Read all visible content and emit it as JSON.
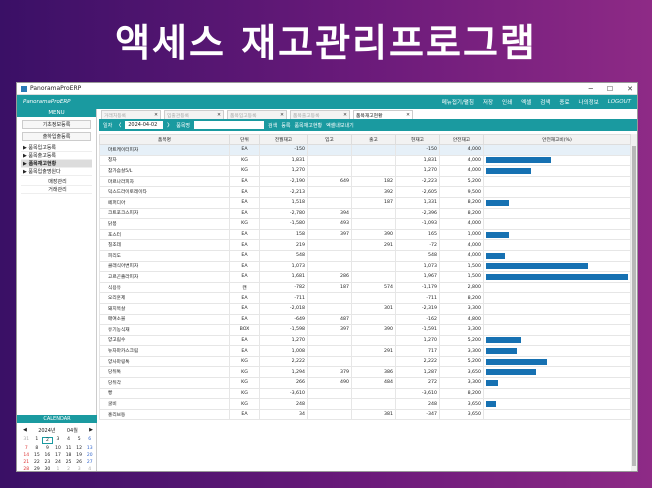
{
  "banner": {
    "title": "액세스 재고관리프로그램"
  },
  "window": {
    "title": "PanoramaProERP",
    "controls": [
      "─",
      "☐",
      "✕"
    ]
  },
  "topbar": {
    "brand": "PanoramaProERP",
    "menu": [
      "메뉴접기/펼침",
      "저장",
      "인쇄",
      "엑셀",
      "검색",
      "종료",
      "나의정보"
    ],
    "user": "LOGOUT"
  },
  "sidebar": {
    "menu_header": "MENU",
    "buttons": [
      "기초정보등록",
      "출하입출등록"
    ],
    "tree": [
      {
        "label": "▶ 품목입고등록",
        "active": false
      },
      {
        "label": "▶ 품목출고등록",
        "active": false
      },
      {
        "label": "▶ 품목재고현황",
        "active": true
      },
      {
        "label": "▶ 품목입출명원다",
        "active": false
      }
    ],
    "tree2": [
      "매장관리",
      "거래관리"
    ]
  },
  "calendar": {
    "header": "CALENDAR",
    "prev": "◀",
    "year": "2024년",
    "month": "04월",
    "next": "▶",
    "days": [
      "31",
      "1",
      "2",
      "3",
      "4",
      "5",
      "6",
      "7",
      "8",
      "9",
      "10",
      "11",
      "12",
      "13",
      "14",
      "15",
      "16",
      "17",
      "18",
      "19",
      "20",
      "21",
      "22",
      "23",
      "24",
      "25",
      "26",
      "27",
      "28",
      "29",
      "30",
      "1",
      "2",
      "3",
      "4",
      "5",
      "6",
      "7",
      "8",
      "9",
      "10",
      "11"
    ]
  },
  "tabs": [
    {
      "label": "거래처등록",
      "active": false
    },
    {
      "label": "입출관등록",
      "active": false
    },
    {
      "label": "품목입고등록",
      "active": false
    },
    {
      "label": "품목출고등록",
      "active": false
    },
    {
      "label": "품목재고현황",
      "active": true
    }
  ],
  "toolbar": {
    "date_label": "일자",
    "prev": "〈",
    "date": "2024-04-02",
    "next": "〉",
    "item_label": "품목명",
    "search": "검색",
    "register": "등록",
    "item_status": "품목재고현황",
    "excel": "엑셀내보내기"
  },
  "table": {
    "headers": [
      "품목명",
      "단위",
      "전월재고",
      "입고",
      "출고",
      "현재고",
      "안전재고",
      "안전재고비(%)"
    ],
    "rows": [
      {
        "name": "마트케이터피자",
        "unit": "EA",
        "prev": "-150",
        "in": "",
        "out": "",
        "cur": "-150",
        "safe": "4,000",
        "pct": 0
      },
      {
        "name": "청자",
        "unit": "KG",
        "prev": "1,831",
        "in": "",
        "out": "",
        "cur": "1,831",
        "safe": "4,000",
        "pct": 45.8
      },
      {
        "name": "참가슴살5/L",
        "unit": "KG",
        "prev": "1,270",
        "in": "",
        "out": "",
        "cur": "1,270",
        "safe": "4,000",
        "pct": 31.8
      },
      {
        "name": "마르나라피자",
        "unit": "EA",
        "prev": "-2,190",
        "in": "649",
        "out": "182",
        "cur": "-2,223",
        "safe": "5,200",
        "pct": 0
      },
      {
        "name": "덕스드라이토레이타",
        "unit": "EA",
        "prev": "-2,213",
        "in": "",
        "out": "392",
        "cur": "-2,605",
        "safe": "9,500",
        "pct": 0
      },
      {
        "name": "페퍼디아",
        "unit": "EA",
        "prev": "1,518",
        "in": "",
        "out": "187",
        "cur": "1,331",
        "safe": "8,200",
        "pct": 16.2
      },
      {
        "name": "크트포크스피자",
        "unit": "EA",
        "prev": "-2,780",
        "in": "394",
        "out": "",
        "cur": "-2,396",
        "safe": "8,200",
        "pct": 0
      },
      {
        "name": "닭봉",
        "unit": "KG",
        "prev": "-1,580",
        "in": "493",
        "out": "",
        "cur": "-1,093",
        "safe": "4,000",
        "pct": 0
      },
      {
        "name": "포스터",
        "unit": "EA",
        "prev": "158",
        "in": "397",
        "out": "390",
        "cur": "165",
        "safe": "1,000",
        "pct": 16.5
      },
      {
        "name": "칠조데",
        "unit": "EA",
        "prev": "219",
        "in": "",
        "out": "291",
        "cur": "-72",
        "safe": "4,000",
        "pct": 0
      },
      {
        "name": "피리도",
        "unit": "EA",
        "prev": "548",
        "in": "",
        "out": "",
        "cur": "548",
        "safe": "4,000",
        "pct": 13.7
      },
      {
        "name": "클래식아변피자",
        "unit": "EA",
        "prev": "1,073",
        "in": "",
        "out": "",
        "cur": "1,073",
        "safe": "1,500",
        "pct": 71.5
      },
      {
        "name": "고르곤졸라피자",
        "unit": "EA",
        "prev": "1,681",
        "in": "286",
        "out": "",
        "cur": "1,967",
        "safe": "1,500",
        "pct": 100
      },
      {
        "name": "식용유",
        "unit": "캔",
        "prev": "-782",
        "in": "187",
        "out": "574",
        "cur": "-1,179",
        "safe": "2,800",
        "pct": 0
      },
      {
        "name": "오리훈제",
        "unit": "EA",
        "prev": "-711",
        "in": "",
        "out": "",
        "cur": "-711",
        "safe": "8,200",
        "pct": 0
      },
      {
        "name": "돼지목살",
        "unit": "EA",
        "prev": "-2,018",
        "in": "",
        "out": "301",
        "cur": "-2,319",
        "safe": "3,300",
        "pct": 0
      },
      {
        "name": "매여소블",
        "unit": "EA",
        "prev": "-649",
        "in": "487",
        "out": "",
        "cur": "-162",
        "safe": "4,800",
        "pct": 0
      },
      {
        "name": "유기농식재",
        "unit": "BOX",
        "prev": "-1,598",
        "in": "397",
        "out": "390",
        "cur": "-1,591",
        "safe": "3,300",
        "pct": 0
      },
      {
        "name": "양고림수",
        "unit": "EA",
        "prev": "1,270",
        "in": "",
        "out": "",
        "cur": "1,270",
        "safe": "5,200",
        "pct": 24.4
      },
      {
        "name": "뉴자마카스크림",
        "unit": "EA",
        "prev": "1,008",
        "in": "",
        "out": "291",
        "cur": "717",
        "safe": "3,300",
        "pct": 21.7
      },
      {
        "name": "양사마링톡",
        "unit": "KG",
        "prev": "2,222",
        "in": "",
        "out": "",
        "cur": "2,222",
        "safe": "5,200",
        "pct": 42.7
      },
      {
        "name": "당뒤톡",
        "unit": "KG",
        "prev": "1,294",
        "in": "379",
        "out": "386",
        "cur": "1,287",
        "safe": "3,650",
        "pct": 35.3
      },
      {
        "name": "당뒤각",
        "unit": "KG",
        "prev": "266",
        "in": "490",
        "out": "484",
        "cur": "272",
        "safe": "3,300",
        "pct": 8.2
      },
      {
        "name": "빵",
        "unit": "KG",
        "prev": "-3,610",
        "in": "",
        "out": "",
        "cur": "-3,610",
        "safe": "8,200",
        "pct": 0
      },
      {
        "name": "굴비",
        "unit": "KG",
        "prev": "248",
        "in": "",
        "out": "",
        "cur": "248",
        "safe": "3,650",
        "pct": 6.8
      },
      {
        "name": "홍리브등",
        "unit": "EA",
        "prev": "34",
        "in": "",
        "out": "381",
        "cur": "-347",
        "safe": "3,650",
        "pct": 0
      }
    ]
  },
  "colors": {
    "teal": "#1a9aa0",
    "bar": "#1671b2",
    "banner_left": "#3a1066",
    "banner_right": "#8e2a86"
  }
}
